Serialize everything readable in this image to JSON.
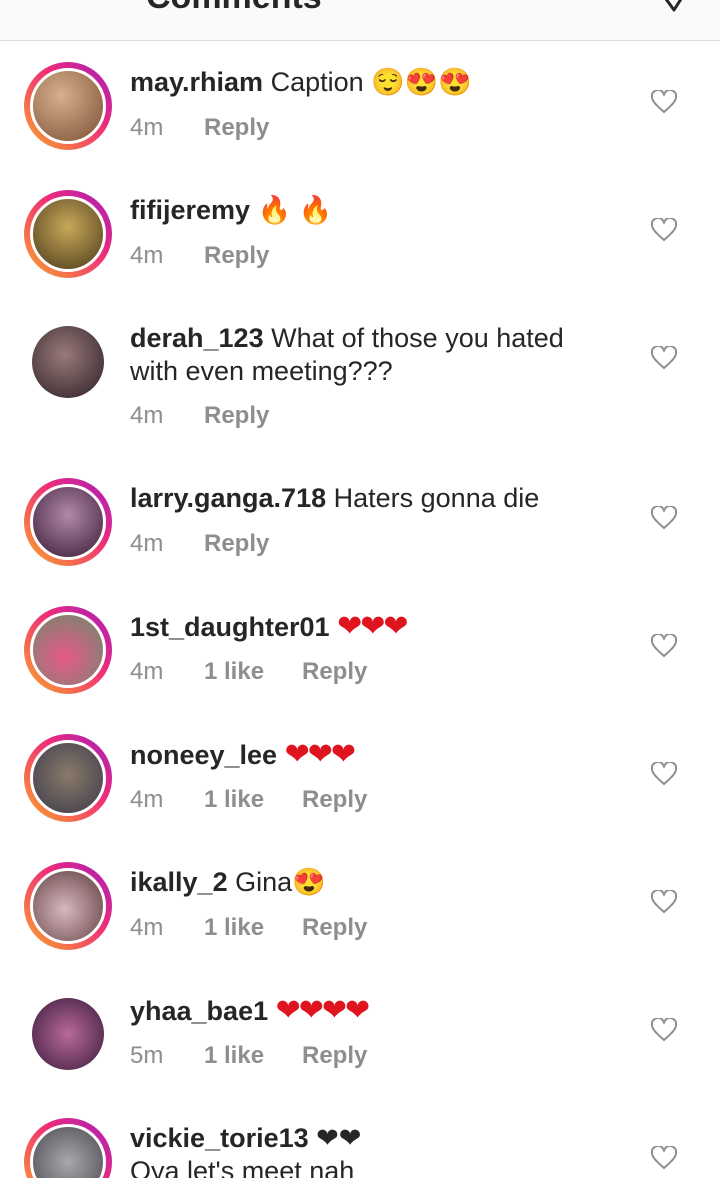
{
  "header": {
    "title": "Comments"
  },
  "comments": [
    {
      "username": "may.rhiam",
      "text": "Caption 😌😍😍",
      "time": "4m",
      "likes": "",
      "reply": "Reply",
      "avatar_colors": [
        "#c49a7a",
        "#7a4f33"
      ],
      "story_ring": true
    },
    {
      "username": "fifijeremy",
      "text": "🔥 🔥",
      "time": "4m",
      "likes": "",
      "reply": "Reply",
      "avatar_colors": [
        "#b89a4a",
        "#4a3a1a"
      ],
      "story_ring": true
    },
    {
      "username": "derah_123",
      "text": "What of those you hated with even meeting???",
      "time": "4m",
      "likes": "",
      "reply": "Reply",
      "avatar_colors": [
        "#8a6a6a",
        "#2a1e24"
      ],
      "story_ring": false
    },
    {
      "username": "larry.ganga.718",
      "text": "Haters gonna die",
      "time": "4m",
      "likes": "",
      "reply": "Reply",
      "avatar_colors": [
        "#a07a9a",
        "#3a1a36"
      ],
      "story_ring": true
    },
    {
      "username": "1st_daughter01",
      "text": "❤❤❤",
      "time": "4m",
      "likes": "1 like",
      "reply": "Reply",
      "avatar_colors": [
        "#e85a8a",
        "#6a8a6a"
      ],
      "story_ring": true
    },
    {
      "username": "noneey_lee",
      "text": "❤❤❤",
      "time": "4m",
      "likes": "1 like",
      "reply": "Reply",
      "avatar_colors": [
        "#7a6a5a",
        "#3a3a4a"
      ],
      "story_ring": true
    },
    {
      "username": "ikally_2",
      "text": "Gina😍",
      "time": "4m",
      "likes": "1 like",
      "reply": "Reply",
      "avatar_colors": [
        "#d8b8c0",
        "#5a3a3a"
      ],
      "story_ring": true
    },
    {
      "username": "yhaa_bae1",
      "text": "❤❤❤❤",
      "time": "5m",
      "likes": "1 like",
      "reply": "Reply",
      "avatar_colors": [
        "#a85a8a",
        "#3a1a3a"
      ],
      "story_ring": false
    },
    {
      "username": "vickie_torie13",
      "text": "❤❤ Oya let's meet nah",
      "time": "",
      "likes": "",
      "reply": "",
      "avatar_colors": [
        "#9a9aa0",
        "#4a4a50"
      ],
      "story_ring": true
    }
  ],
  "colors": {
    "accent_text": "#262626",
    "meta_text": "#8e8e8e",
    "heart_red": "#e0141e"
  }
}
